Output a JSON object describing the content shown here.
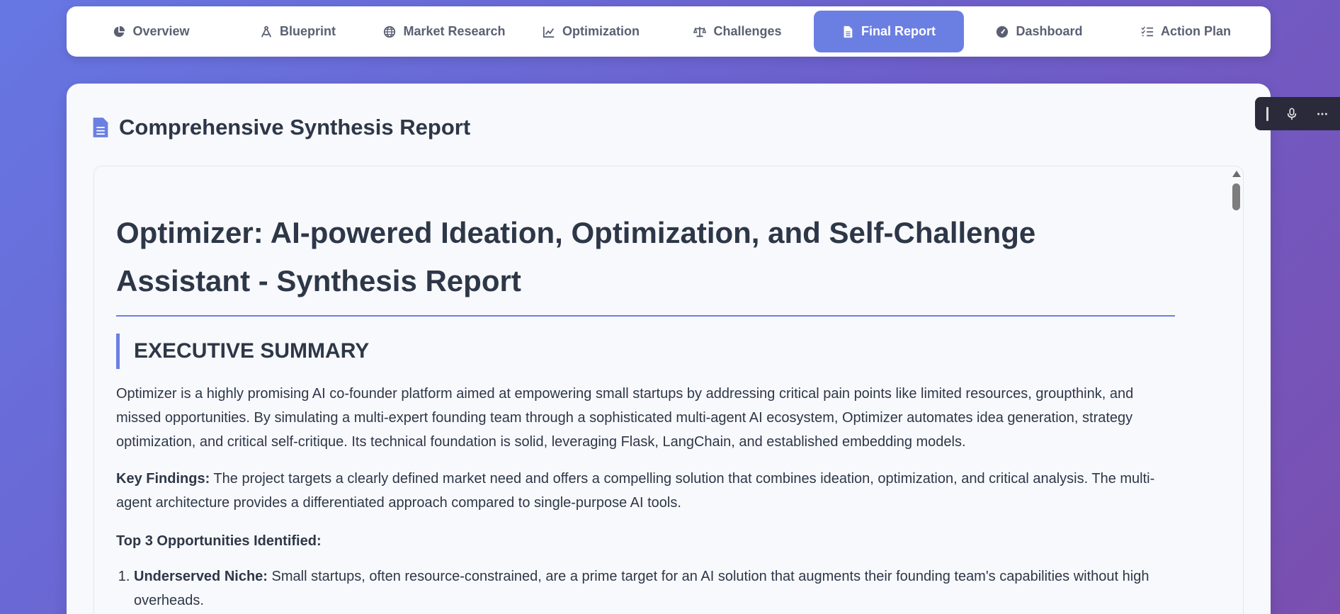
{
  "tabs": [
    {
      "label": "Overview",
      "icon": "pie-chart-icon"
    },
    {
      "label": "Blueprint",
      "icon": "compass-drafting-icon"
    },
    {
      "label": "Market Research",
      "icon": "globe-icon"
    },
    {
      "label": "Optimization",
      "icon": "line-chart-icon"
    },
    {
      "label": "Challenges",
      "icon": "scale-balance-icon"
    },
    {
      "label": "Final Report",
      "icon": "document-icon",
      "active": true
    },
    {
      "label": "Dashboard",
      "icon": "gauge-icon"
    },
    {
      "label": "Action Plan",
      "icon": "list-check-icon"
    }
  ],
  "card": {
    "title": "Comprehensive Synthesis Report",
    "icon": "document-icon"
  },
  "report": {
    "h1": "Optimizer: AI-powered Ideation, Optimization, and Self-Challenge Assistant - Synthesis Report",
    "section_title": "EXECUTIVE SUMMARY",
    "summary": "Optimizer is a highly promising AI co-founder platform aimed at empowering small startups by addressing critical pain points like limited resources, groupthink, and missed opportunities. By simulating a multi-expert founding team through a sophisticated multi-agent AI ecosystem, Optimizer automates idea generation, strategy optimization, and critical self-critique. Its technical foundation is solid, leveraging Flask, LangChain, and established embedding models.",
    "key_findings_label": "Key Findings:",
    "key_findings_text": " The project targets a clearly defined market need and offers a compelling solution that combines ideation, optimization, and critical analysis. The multi-agent architecture provides a differentiated approach compared to single-purpose AI tools.",
    "opportunities_heading": "Top 3 Opportunities Identified:",
    "opportunities": [
      {
        "label": "Underserved Niche:",
        "text": " Small startups, often resource-constrained, are a prime target for an AI solution that augments their founding team's capabilities without high overheads."
      }
    ]
  },
  "floating_toolbar": {
    "icons": [
      "grip-handle-icon",
      "microphone-icon",
      "more-options-icon"
    ]
  },
  "colors": {
    "accent": "#6b7fe3",
    "text": "#2d3748",
    "tab_text": "#5a6072"
  }
}
